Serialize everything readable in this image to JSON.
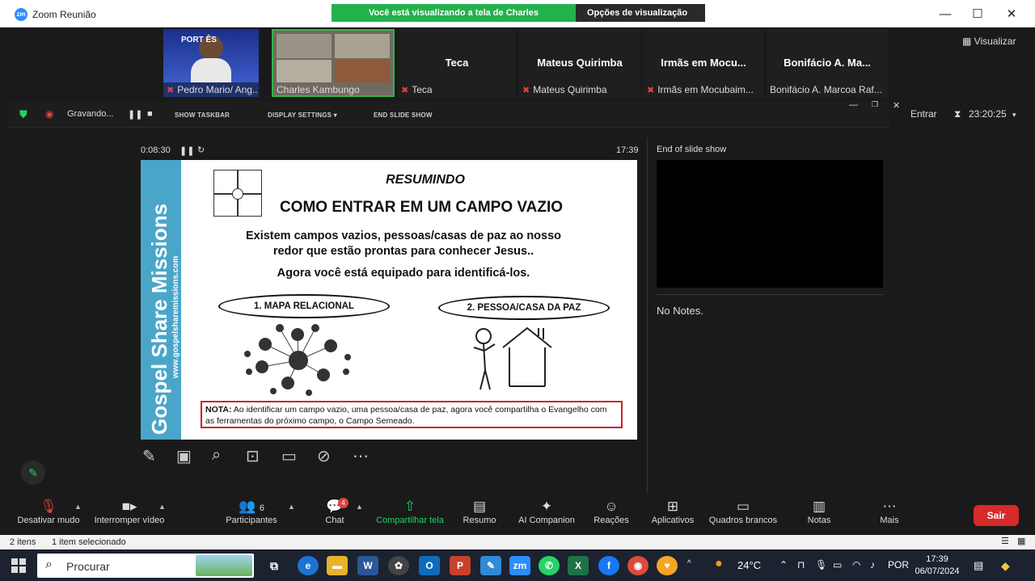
{
  "window": {
    "app_icon": "zm",
    "title": "Zoom Reunião",
    "banner_text": "Você está visualizando a tela de Charles Kambungo",
    "view_options": "Opções de visualização ▾",
    "btn_minimize": "—",
    "btn_maximize": "☐",
    "btn_close": "✕"
  },
  "gallery": {
    "visualizar": "Visualizar",
    "participants": [
      {
        "name": "",
        "footer": "Pedro Mario/ Ang..."
      },
      {
        "name": "",
        "footer": "Charles Kambungo"
      },
      {
        "name": "Teca",
        "footer": "Teca"
      },
      {
        "name": "Mateus Quirimba",
        "footer": "Mateus Quirimba"
      },
      {
        "name": "Irmãs em Mocu...",
        "footer": "Irmãs em Mocubaim..."
      },
      {
        "name": "Bonifácio A. Ma...",
        "footer": "Bonifácio A. Marcoa Raf..."
      }
    ],
    "tile0_overlay": "PORT    ÊS"
  },
  "presenter_toolbar": {
    "recording": "Gravando...",
    "show_taskbar": "SHOW TASKBAR",
    "display_settings": "DISPLAY SETTINGS ▾",
    "end_slide_show": "END SLIDE SHOW",
    "entrar": "Entrar",
    "timer": "23:20:25"
  },
  "slide": {
    "elapsed": "0:08:30",
    "clock": "17:39",
    "side_title": "Gospel Share Missions",
    "side_url": "www.gospelsharemissions.com",
    "resumindo": "RESUMINDO",
    "title": "COMO ENTRAR EM UM CAMPO VAZIO",
    "line1": "Existem campos vazios, pessoas/casas de paz ao nosso",
    "line2": "redor que estão prontas para conhecer Jesus..",
    "line3": "Agora você está equipado para identificá-los.",
    "oval1": "1. MAPA RELACIONAL",
    "oval2": "2. PESSOA/CASA DA PAZ",
    "nota_label": "NOTA:",
    "nota_text": " Ao identificar um campo vazio, uma pessoa/casa de paz, agora você compartilha o Evangelho com as ferramentas do próximo campo, o Campo Semeado."
  },
  "right_panel": {
    "title": "End of slide show",
    "notes": "No Notes."
  },
  "controls": {
    "mute": "Desativar mudo",
    "video": "Interromper vídeo",
    "participants": "Participantes",
    "participants_count": "6",
    "chat": "Chat",
    "chat_badge": "4",
    "share": "Compartilhar tela",
    "resumo": "Resumo",
    "ai": "AI Companion",
    "reacoes": "Reações",
    "apps": "Aplicativos",
    "boards": "Quadros brancos",
    "notas": "Notas",
    "mais": "Mais",
    "sair": "Sair"
  },
  "status_bar": {
    "items": "2 itens",
    "selected": "1 item selecionado"
  },
  "taskbar": {
    "search": "Procurar",
    "weather": "24°C",
    "language": "POR",
    "time": "17:39",
    "date": "06/07/2024"
  },
  "colors": {
    "zoom_blue": "#2d8cff",
    "banner_green": "#23b14d",
    "share_green": "#23d160",
    "leave_red": "#d72a2a",
    "slide_band": "#4aa6c9",
    "nota_border": "#d21f26"
  }
}
